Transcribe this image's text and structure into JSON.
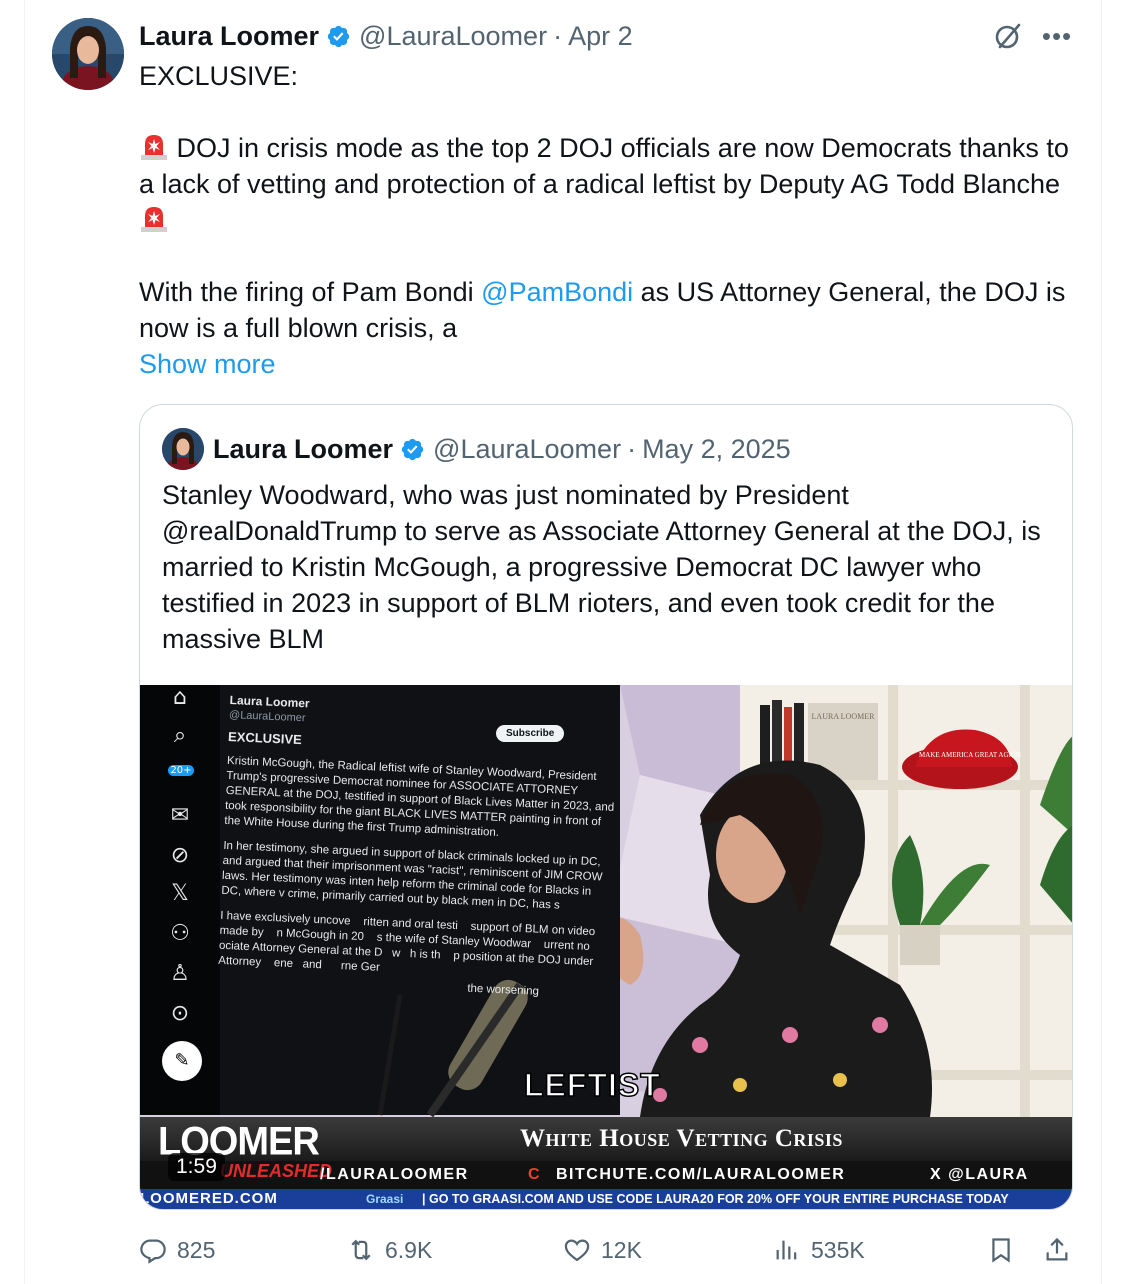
{
  "tweet": {
    "author_name": "Laura Loomer",
    "handle": "@LauraLoomer",
    "separator": "·",
    "date": "Apr 2",
    "text_line1": "EXCLUSIVE:",
    "text_para2_a": " DOJ in crisis mode as the top 2 DOJ officials are now Democrats thanks to a lack of vetting and protection of a radical leftist by Deputy AG Todd Blanche",
    "text_para3_a": "With the firing of Pam Bondi ",
    "mention": "@PamBondi",
    "text_para3_b": " as US Attorney General, the DOJ is now is a full blown crisis, a",
    "show_more": "Show more"
  },
  "quote": {
    "author_name": "Laura Loomer",
    "handle": "@LauraLoomer",
    "separator": "·",
    "date": "May 2, 2025",
    "text": "Stanley Woodward, who was just nominated by President @realDonaldTrump to serve as Associate Attorney General at the DOJ, is married to Kristin McGough, a progressive Democrat DC lawyer who testified in 2023 in support of BLM rioters, and even took credit for the massive BLM"
  },
  "video": {
    "screen_name": "Laura Loomer",
    "screen_handle": "@LauraLoomer",
    "subscribe": "Subscribe",
    "screen_badge": "20+",
    "screen_exclusive": "EXCLUSIVE",
    "screen_para1": "Kristin McGough, the Radical leftist wife of Stanley Woodward, President Trump's progressive Democrat nominee for ASSOCIATE ATTORNEY GENERAL at the DOJ, testified in support of Black Lives Matter in 2023, and took responsibility for the giant BLACK LIVES MATTER painting in front of the White House during the first Trump administration.",
    "screen_para2": "In her testimony, she argued in support of black criminals locked up in DC, and argued that their imprisonment was \"racist\", reminiscent of JIM CROW laws. Her testimony was inten help reform the criminal code for Blacks in DC, where v crime, primarily carried out by black men in DC, has s",
    "screen_para3": "I have exclusively uncove    ritten and oral testi    support of BLM on video made by    n McGough in 20    s the wife of Stanley Woodwar    urrent no    ociate Attorney General at the D   w   h is th    p position at the DOJ under Attorney    ene   and      rne Ger",
    "screen_para4": "the worsening",
    "caption": "LEFTIST",
    "banner_title": "White House Vetting Crisis",
    "logo": "LOOMER",
    "logo_sub": "UNLEASHED",
    "site": "LOOMERED.COM",
    "handle1": "/LAURALOOMER",
    "handle2": "BITCHUTE.COM/LAURALOOMER",
    "handle3": "X @LAURA",
    "promo_brand": "Graasi",
    "promo": "| GO TO GRAASI.COM AND USE CODE LAURA20 FOR 20% OFF YOUR ENTIRE PURCHASE TODAY",
    "duration": "1:59",
    "shelf_book": "LAURA LOOMER",
    "hat_text": "MAKE AMERICA GREAT AGAIN"
  },
  "actions": {
    "replies": "825",
    "reposts": "6.9K",
    "likes": "12K",
    "views": "535K"
  },
  "colors": {
    "link": "#1d9bf0",
    "secondary_text": "#536471",
    "verified": "#1d9bf0",
    "border": "#cfd9de"
  }
}
